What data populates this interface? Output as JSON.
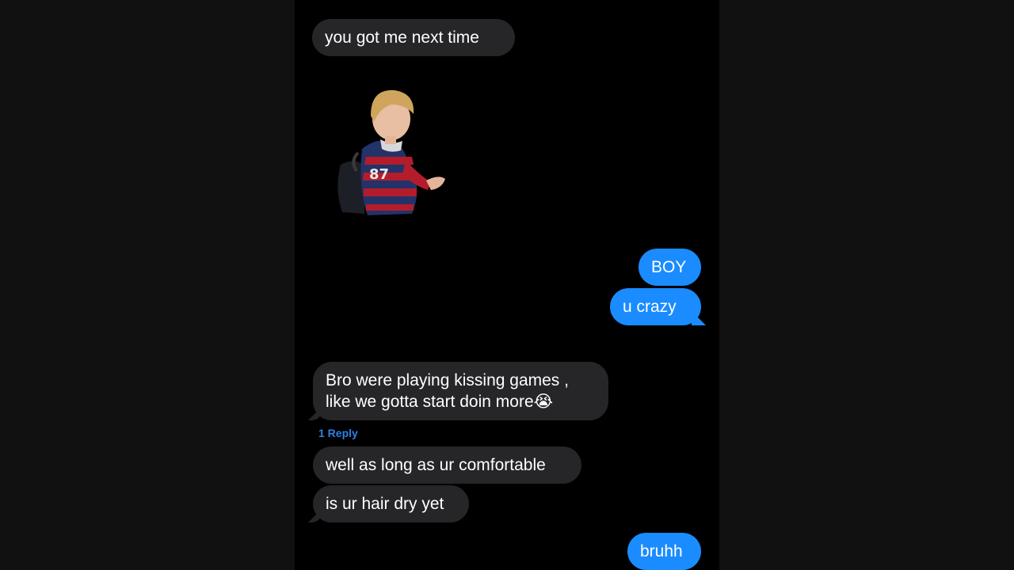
{
  "conversation": {
    "messages": [
      {
        "direction": "incoming",
        "text": "you got me next time"
      },
      {
        "direction": "incoming",
        "sticker": "person-sticker"
      },
      {
        "direction": "outgoing",
        "text": "BOY"
      },
      {
        "direction": "outgoing",
        "text": "u crazy"
      },
      {
        "direction": "incoming",
        "line1": "Bro were playing kissing games ,",
        "line2": "like we gotta start doin more😭"
      },
      {
        "direction": "incoming",
        "text": "well as long as ur comfortable"
      },
      {
        "direction": "incoming",
        "text": "is ur hair dry yet"
      },
      {
        "direction": "outgoing",
        "text": "bruhh"
      }
    ],
    "reply_thread_label": "1 Reply"
  },
  "colors": {
    "incoming_bubble": "#262628",
    "outgoing_bubble": "#1a8cff",
    "reply_link": "#2f7fe6",
    "background": "#000000"
  },
  "icons": {
    "sticker": "person-sticker"
  }
}
